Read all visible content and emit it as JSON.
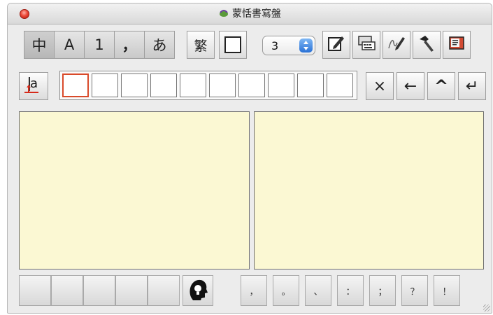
{
  "window": {
    "title": "蒙恬書寫盤"
  },
  "toolbar": {
    "modes": [
      {
        "label": "中",
        "selected": true
      },
      {
        "label": "A",
        "selected": false
      },
      {
        "label": "1",
        "selected": false
      },
      {
        "label": "，",
        "selected": false
      },
      {
        "label": "あ",
        "selected": false
      }
    ],
    "traditional_label": "繁",
    "candidate_count": "3",
    "icons": [
      "handwriting-window-icon",
      "keyboard-icon",
      "pen-settings-icon",
      "hammer-tools-icon",
      "notes-icon"
    ]
  },
  "candidates": {
    "convert_icon": "case-convert-icon",
    "slots": [
      "",
      "",
      "",
      "",
      "",
      "",
      "",
      "",
      "",
      ""
    ],
    "actions": [
      {
        "name": "delete",
        "symbol": "×"
      },
      {
        "name": "backspace",
        "symbol": "←"
      },
      {
        "name": "up",
        "symbol": "^"
      },
      {
        "name": "enter",
        "symbol": "↵"
      }
    ]
  },
  "writing_pads": {
    "color": "#fbf8d3"
  },
  "bottom": {
    "slots": [
      "",
      "",
      "",
      "",
      ""
    ],
    "idea_icon": "lightbulb-head-icon",
    "punctuation": [
      "，",
      "。",
      "、",
      "：",
      "；",
      "？",
      "！"
    ]
  },
  "colors": {
    "accent": "#2a71d6",
    "close": "#ec4a3a",
    "pad": "#fbf8d3",
    "active_cell": "#d94a2a"
  }
}
